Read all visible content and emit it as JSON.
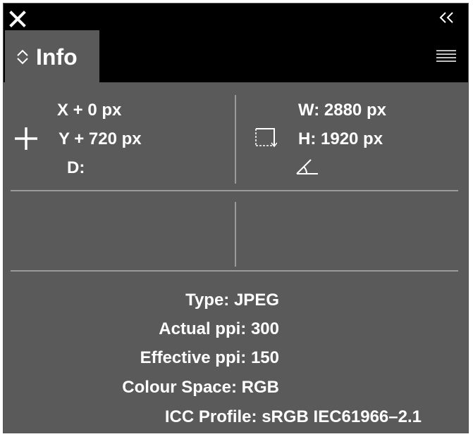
{
  "panel": {
    "close_icon": "close-icon",
    "collapse_icon": "double-chevron-left-icon",
    "menu_icon": "hamburger-menu-icon"
  },
  "tab": {
    "label": "Info",
    "icon": "up-down-chevron-icon"
  },
  "position": {
    "x": "X + 0 px",
    "y": "Y + 720 px",
    "d": "D:",
    "icon": "crosshair-icon"
  },
  "size": {
    "w": "W: 2880 px",
    "h": "H: 1920 px",
    "size_icon": "bounding-box-icon",
    "angle_icon": "angle-icon"
  },
  "details": {
    "type": "Type: JPEG",
    "actual_ppi": "Actual ppi: 300",
    "effective_ppi": "Effective ppi: 150",
    "colour_space": "Colour Space: RGB",
    "icc_profile": "ICC Profile: sRGB IEC61966–2.1"
  },
  "colors": {
    "panel_bg": "#5a5a5a",
    "header_bg": "#000000",
    "divider": "#9a9a9a",
    "text": "#ffffff"
  }
}
